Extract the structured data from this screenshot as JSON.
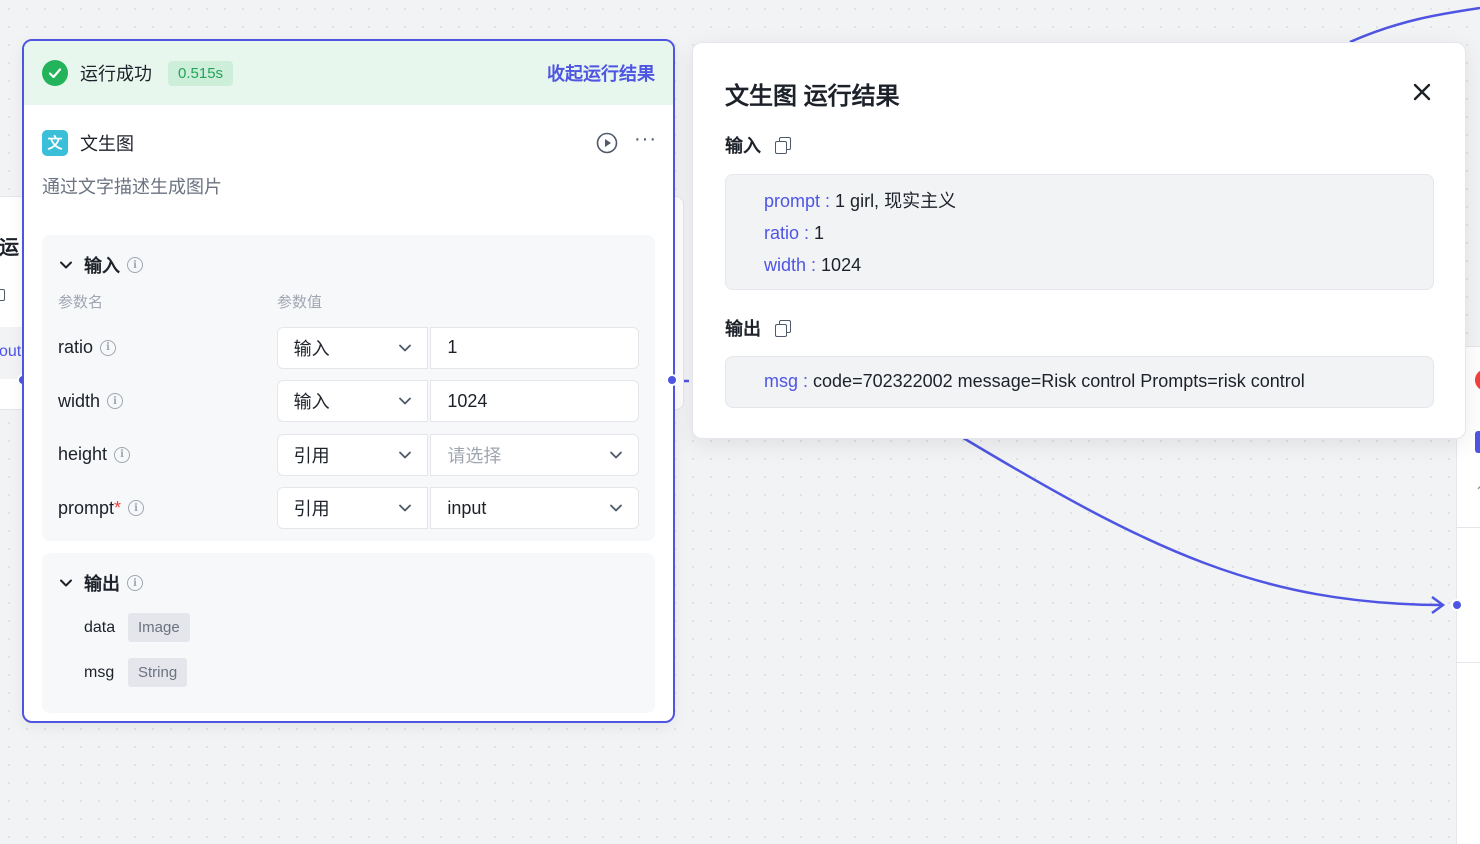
{
  "node": {
    "status": "运行成功",
    "duration": "0.515s",
    "collapse_label": "收起运行结果",
    "type_icon_char": "文",
    "title": "文生图",
    "description": "通过文字描述生成图片",
    "input_section_title": "输入",
    "col_param_name": "参数名",
    "col_param_value": "参数值",
    "params": [
      {
        "name": "ratio",
        "required": "",
        "type": "输入",
        "value": "1"
      },
      {
        "name": "width",
        "required": "",
        "type": "输入",
        "value": "1024"
      },
      {
        "name": "height",
        "required": "",
        "type": "引用",
        "placeholder": "请选择"
      },
      {
        "name": "prompt",
        "required": "*",
        "type": "引用",
        "value": "input"
      }
    ],
    "output_section_title": "输出",
    "outputs": [
      {
        "name": "data",
        "type": "Image"
      },
      {
        "name": "msg",
        "type": "String"
      }
    ]
  },
  "result_panel": {
    "title": "文生图 运行结果",
    "input_label": "输入",
    "inputs": [
      {
        "key": "prompt :",
        "value": "1 girl, 现实主义"
      },
      {
        "key": "ratio :",
        "value": "1"
      },
      {
        "key": "width :",
        "value": "1024"
      }
    ],
    "output_label": "输出",
    "outputs": [
      {
        "key": "msg :",
        "value": "code=702322002 message=Risk control Prompts=risk control"
      }
    ]
  },
  "left_node": {
    "title_fragment": "运",
    "text_fragment": "out"
  },
  "right_node": {
    "text_fragment": "亻"
  },
  "colors": {
    "accent": "#4e55e3",
    "success": "#23b45b",
    "success_bg": "#e8f7ee",
    "error": "#f53f3f"
  }
}
